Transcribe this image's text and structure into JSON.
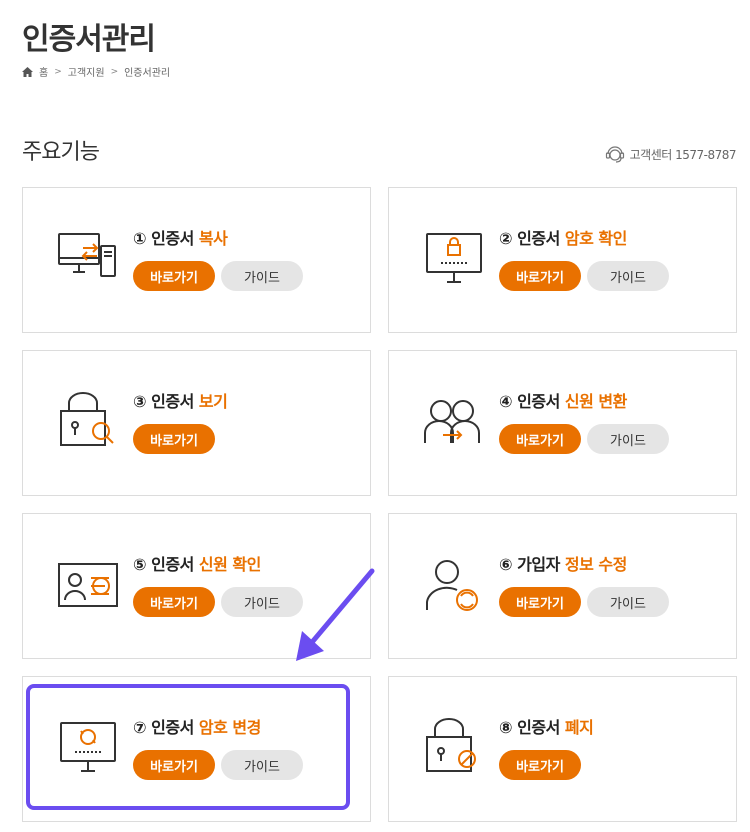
{
  "header": {
    "title": "인증서관리",
    "breadcrumb": [
      "홈",
      "고객지원",
      "인증서관리"
    ]
  },
  "section": {
    "title": "주요기능",
    "support": "고객센터 1577-8787"
  },
  "colors": {
    "accent": "#e97100",
    "highlight": "#6b4df0",
    "guide_bg": "#e5e5e5"
  },
  "cards": [
    {
      "num": "①",
      "prefix": "인증서",
      "hl": "복사",
      "go": "바로가기",
      "guide": "가이드",
      "icon": "pc-transfer-icon"
    },
    {
      "num": "②",
      "prefix": "인증서",
      "hl": "암호 확인",
      "go": "바로가기",
      "guide": "가이드",
      "icon": "monitor-lock-icon"
    },
    {
      "num": "③",
      "prefix": "인증서",
      "hl": "보기",
      "go": "바로가기",
      "guide": "가이드",
      "icon": "lock-search-icon"
    },
    {
      "num": "④",
      "prefix": "인증서",
      "hl": "신원 변환",
      "go": "바로가기",
      "guide": "가이드",
      "icon": "users-transfer-icon"
    },
    {
      "num": "⑤",
      "prefix": "인증서",
      "hl": "신원 확인",
      "go": "바로가기",
      "guide": "가이드",
      "icon": "id-card-icon"
    },
    {
      "num": "⑥",
      "prefix": "가입자",
      "hl": "정보 수정",
      "go": "바로가기",
      "guide": "가이드",
      "icon": "user-refresh-icon"
    },
    {
      "num": "⑦",
      "prefix": "인증서",
      "hl": "암호 변경",
      "go": "바로가기",
      "guide": "가이드",
      "icon": "monitor-refresh-icon"
    },
    {
      "num": "⑧",
      "prefix": "인증서",
      "hl": "폐지",
      "go": "바로가기",
      "icon": "lock-ban-icon"
    }
  ]
}
